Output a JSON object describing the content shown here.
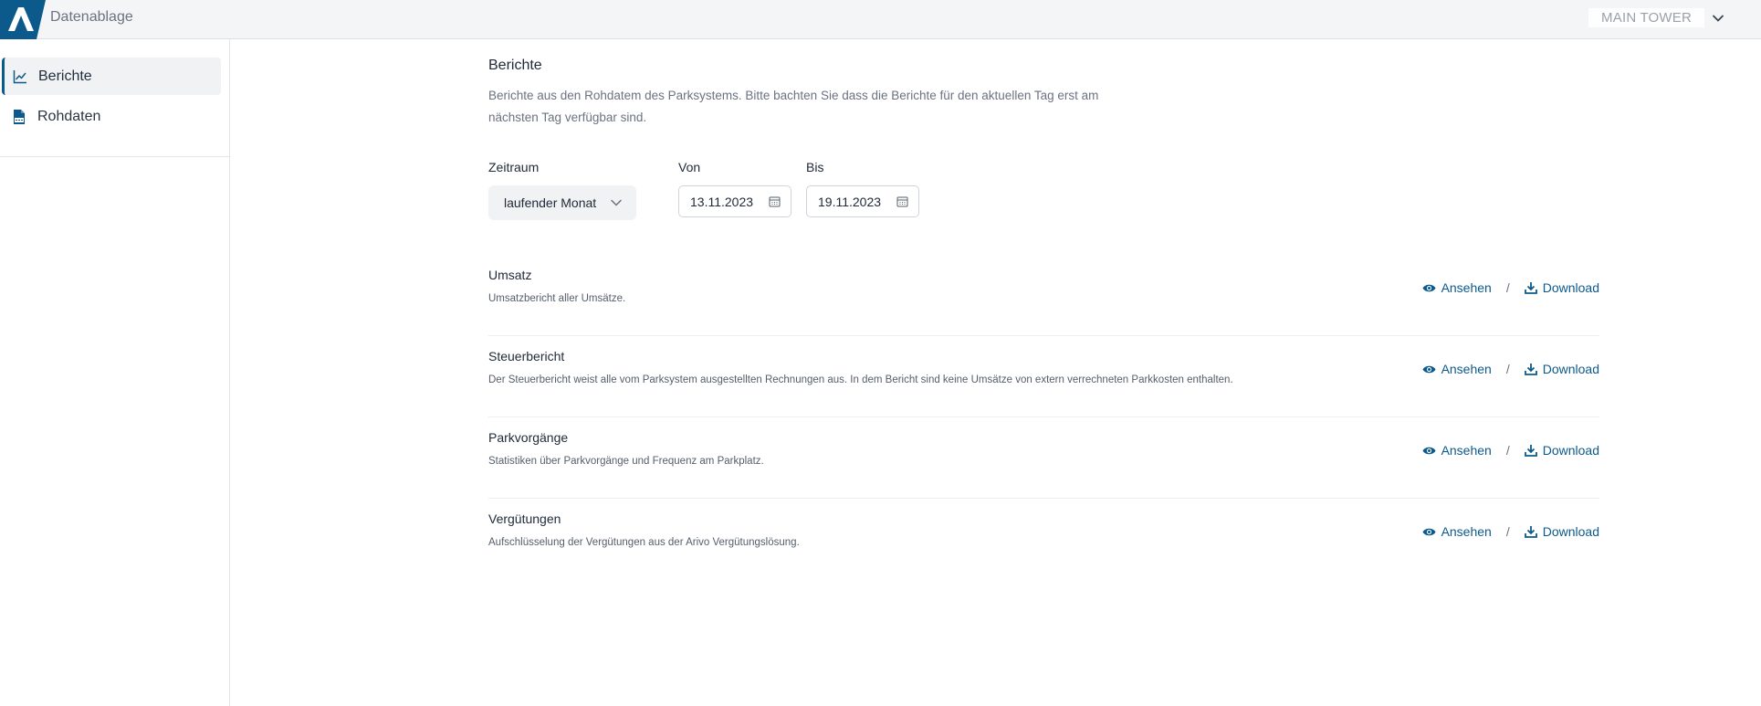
{
  "header": {
    "app_title": "Datenablage",
    "org_name": "MAIN TOWER"
  },
  "sidebar": {
    "items": [
      {
        "label": "Berichte",
        "icon": "chart-line-icon",
        "active": true
      },
      {
        "label": "Rohdaten",
        "icon": "csv-file-icon",
        "active": false
      }
    ]
  },
  "main": {
    "title": "Berichte",
    "description": "Berichte aus den Rohdatem des Parksystems. Bitte bachten Sie dass die Berichte für den aktuellen Tag erst am nächsten Tag verfügbar sind.",
    "filters": {
      "zeitraum_label": "Zeitraum",
      "zeitraum_value": "laufender Monat",
      "von_label": "Von",
      "von_value": "13.11.2023",
      "bis_label": "Bis",
      "bis_value": "19.11.2023"
    },
    "reports": [
      {
        "title": "Umsatz",
        "description": "Umsatzbericht aller Umsätze."
      },
      {
        "title": "Steuerbericht",
        "description": "Der Steuerbericht weist alle vom Parksystem ausgestellten Rechnungen aus. In dem Bericht sind keine Umsätze von extern verrechneten Parkkosten enthalten."
      },
      {
        "title": "Parkvorgänge",
        "description": "Statistiken über Parkvorgänge und Frequenz am Parkplatz."
      },
      {
        "title": "Vergütungen",
        "description": "Aufschlüsselung der Vergütungen aus der Arivo Vergütungslösung."
      }
    ],
    "actions": {
      "view_label": "Ansehen",
      "separator": "/",
      "download_label": "Download"
    }
  },
  "colors": {
    "accent": "#0c5a8c",
    "sidebar_active_bg": "#f1f2f4",
    "topbar_bg": "#f4f5f7"
  }
}
